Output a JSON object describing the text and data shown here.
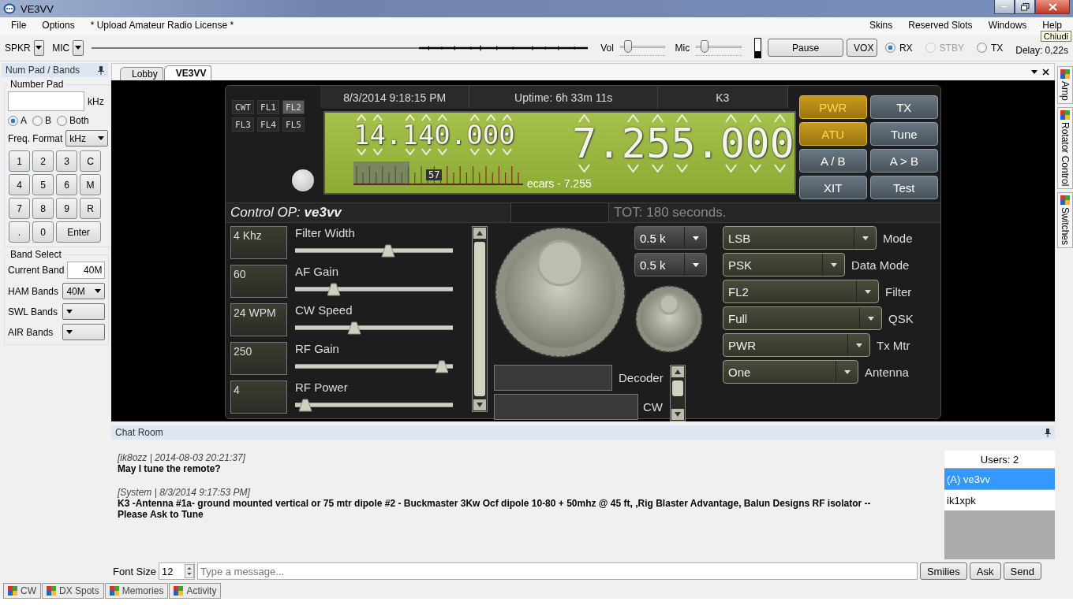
{
  "window": {
    "title": "VE3VV"
  },
  "menu": {
    "left": [
      "File",
      "Options",
      "* Upload Amateur Radio License *"
    ],
    "right": [
      "Skins",
      "Reserved Slots",
      "Windows",
      "Help"
    ]
  },
  "tooltip": "Chiudi",
  "toolbar": {
    "spkr": "SPKR",
    "mic": "MIC",
    "vol": {
      "label": "Vol",
      "level": 0.15
    },
    "mic_gain": {
      "label": "Mic",
      "level": 0.15
    },
    "input_meter": {
      "level": 0.3
    },
    "buttons": [
      "Pause",
      "VOX"
    ],
    "modes": [
      {
        "label": "RX",
        "selected": true,
        "disabled": false
      },
      {
        "label": "STBY",
        "selected": false,
        "disabled": true
      },
      {
        "label": "TX",
        "selected": false,
        "disabled": false
      }
    ],
    "delay": "Delay: 0,22s"
  },
  "num_pad": {
    "title": "Num Pad / Bands",
    "group": "Number Pad",
    "unit": "kHz",
    "vfo_choice": [
      {
        "label": "A",
        "selected": true
      },
      {
        "label": "B",
        "selected": false
      },
      {
        "label": "Both",
        "selected": false
      }
    ],
    "format_label": "Freq. Format",
    "format": "kHz",
    "keys": [
      "1",
      "2",
      "3",
      "C",
      "4",
      "5",
      "6",
      "M",
      "7",
      "8",
      "9",
      "R",
      ".",
      "0",
      "Enter"
    ],
    "band_group": "Band Select",
    "current_band_label": "Current Band",
    "current_band": "40M",
    "bands": [
      {
        "label": "HAM Bands",
        "value": "40M"
      },
      {
        "label": "SWL Bands"
      },
      {
        "label": "AIR Bands"
      }
    ]
  },
  "doc_tabs": [
    {
      "label": "Lobby",
      "selected": false
    },
    {
      "label": "VE3VV",
      "selected": true
    }
  ],
  "radio": {
    "presets": [
      {
        "label": "CWT",
        "selected": false
      },
      {
        "label": "FL1",
        "selected": false
      },
      {
        "label": "FL2",
        "selected": true
      },
      {
        "label": "FL3",
        "selected": false
      },
      {
        "label": "FL4",
        "selected": false
      },
      {
        "label": "FL5",
        "selected": false
      }
    ],
    "datetime": "8/3/2014 9:18:15 PM",
    "uptime": "Uptime: 6h 33m 11s",
    "model": "K3",
    "vfo_a": "14.140.000",
    "vfo_b": "7.255.000",
    "s_meter": {
      "reading": "57",
      "level": 0.33
    },
    "lcd_caption": "ecars - 7.255",
    "buttons": [
      {
        "label": "PWR",
        "on": true
      },
      {
        "label": "TX",
        "on": false
      },
      {
        "label": "ATU",
        "on": true
      },
      {
        "label": "Tune",
        "on": false
      },
      {
        "label": "A / B",
        "on": false
      },
      {
        "label": "A > B",
        "on": false
      },
      {
        "label": "XIT",
        "on": false
      },
      {
        "label": "Test",
        "on": false
      }
    ],
    "control_op": "Control OP: **ve3vv**",
    "tot": "TOT: 180 seconds.",
    "sliders": [
      {
        "value": "4 Khz",
        "label": "Filter Width",
        "level": 0.6
      },
      {
        "value": "60",
        "label": "AF Gain",
        "level": 0.22
      },
      {
        "value": "24 WPM",
        "label": "CW Speed",
        "level": 0.36
      },
      {
        "value": "250",
        "label": "RF Gain",
        "level": 0.97
      },
      {
        "value": "4",
        "label": "RF Power",
        "level": 0.02
      }
    ],
    "bandwidth": [
      "0.5 k",
      "0.5 k"
    ],
    "decoder": [
      "Decoder",
      "CW"
    ],
    "selects": [
      {
        "value": "LSB",
        "label": "Mode"
      },
      {
        "value": "PSK",
        "label": "Data Mode"
      },
      {
        "value": "FL2",
        "label": "Filter"
      },
      {
        "value": "Full",
        "label": "QSK"
      },
      {
        "value": "PWR",
        "label": "Tx Mtr"
      },
      {
        "value": "One",
        "label": "Antenna"
      }
    ]
  },
  "chat": {
    "title": "Chat Room",
    "messages": [
      {
        "meta": "[ik8ozz | 2014-08-03 20:21:37]",
        "text": "May I tune the remote?"
      },
      {
        "meta": "[System | 8/3/2014 9:17:53 PM]",
        "text": "K3 -Antenna #1a- ground mounted vertical or 75 mtr dipole #2 - Buckmaster 3Kw Ocf dipole 10-80 + 50mhz @ 45 ft, ,Rig Blaster Advantage, Balun Designs RF isolator --Please Ask to Tune"
      }
    ],
    "users_header": "Users: 2",
    "users": [
      {
        "name": "(A) ve3vv",
        "selected": true
      },
      {
        "name": "ik1xpk",
        "selected": false
      }
    ],
    "font_size_label": "Font Size",
    "font_size": "12",
    "placeholder": "Type a message...",
    "buttons": [
      "Smilies",
      "Ask",
      "Send"
    ]
  },
  "side_tabs": [
    "Amp",
    "Rotator Control",
    "Switches"
  ],
  "bottom_tabs": [
    "CW",
    "DX Spots",
    "Memories",
    "Activity"
  ]
}
